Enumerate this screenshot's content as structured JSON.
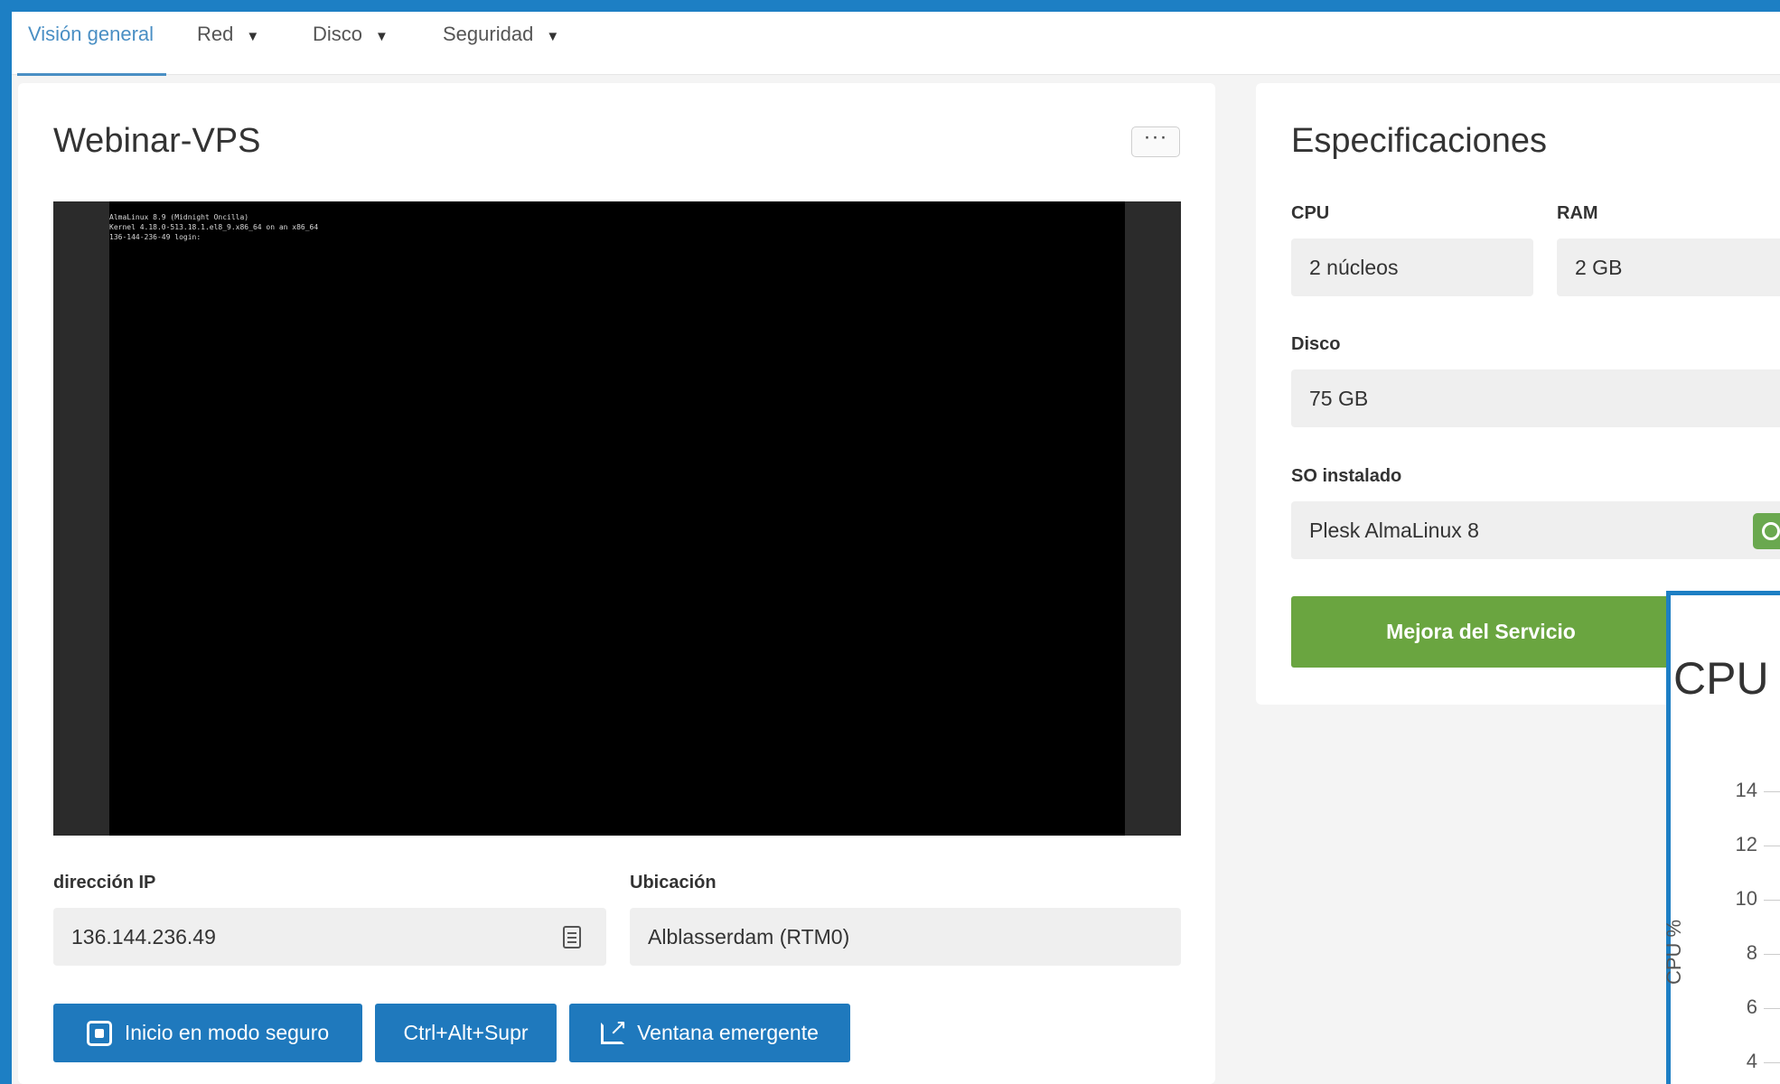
{
  "tabs": [
    {
      "label": "Visión general",
      "active": true
    },
    {
      "label": "Red",
      "dropdown": true
    },
    {
      "label": "Disco",
      "dropdown": true
    },
    {
      "label": "Seguridad",
      "dropdown": true
    }
  ],
  "server": {
    "name": "Webinar-VPS",
    "more_icon": "ellipsis-icon",
    "console_lines": [
      "AlmaLinux 8.9 (Midnight Oncilla)",
      "Kernel 4.18.0-513.18.1.el8_9.x86_64 on an x86_64",
      "",
      "136-144-236-49 login:"
    ],
    "ip_label": "dirección IP",
    "ip_value": "136.144.236.49",
    "location_label": "Ubicación",
    "location_value": "Alblasserdam (RTM0)"
  },
  "actions": {
    "safe_mode": "Inicio en modo seguro",
    "ctrl_alt_del": "Ctrl+Alt+Supr",
    "popup": "Ventana emergente"
  },
  "specs": {
    "title": "Especificaciones",
    "cpu_label": "CPU",
    "cpu_value": "2 núcleos",
    "ram_label": "RAM",
    "ram_value": "2 GB",
    "disk_label": "Disco",
    "disk_value": "75 GB",
    "os_label": "SO instalado",
    "os_value": "Plesk AlmaLinux 8",
    "upgrade_button": "Mejora del Servicio"
  },
  "colors": {
    "accent_blue": "#1f79bd",
    "green": "#6aa540"
  },
  "chart_data": {
    "type": "line",
    "title": "CPU",
    "ylabel": "CPU %",
    "yticks": [
      "14",
      "12",
      "10",
      "8",
      "6",
      "4"
    ],
    "series": []
  }
}
